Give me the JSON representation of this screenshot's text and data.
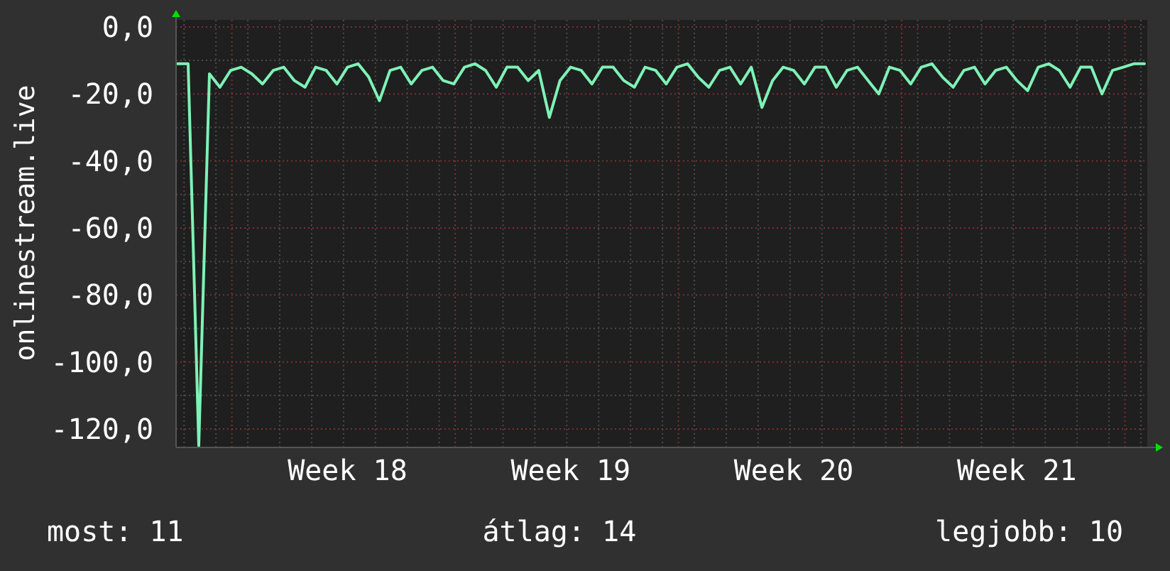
{
  "chart_data": {
    "type": "line",
    "ylabel": "onlinestream.live",
    "grid": true,
    "ylim": [
      -125.5,
      2.1
    ],
    "categories": [
      null,
      null,
      null,
      null,
      null,
      null,
      null,
      null,
      null,
      null,
      null,
      null,
      null,
      null,
      null,
      null,
      "Week 18",
      null,
      null,
      null,
      null,
      null,
      null,
      null,
      null,
      null,
      null,
      null,
      null,
      null,
      null,
      null,
      null,
      null,
      null,
      null,
      null,
      "Week 19",
      null,
      null,
      null,
      null,
      null,
      null,
      null,
      null,
      null,
      null,
      null,
      null,
      null,
      null,
      null,
      null,
      null,
      null,
      null,
      null,
      "Week 20",
      null,
      null,
      null,
      null,
      null,
      null,
      null,
      null,
      null,
      null,
      null,
      null,
      null,
      null,
      null,
      null,
      null,
      null,
      null,
      null,
      "Week 21",
      null,
      null,
      null,
      null,
      null,
      null,
      null,
      null,
      null,
      null,
      null,
      null
    ],
    "yticks": [
      {
        "value": 0,
        "label": "0,0"
      },
      {
        "value": -20,
        "label": "-20,0"
      },
      {
        "value": -40,
        "label": "-40,0"
      },
      {
        "value": -60,
        "label": "-60,0"
      },
      {
        "value": -80,
        "label": "-80,0"
      },
      {
        "value": -100,
        "label": "-100,0"
      },
      {
        "value": -120,
        "label": "-120,0"
      }
    ],
    "series": [
      {
        "color": "#7ef2b6",
        "values": [
          -11,
          -11,
          -125,
          -14,
          -18,
          -13,
          -12,
          -14,
          -17,
          -13,
          -12,
          -16,
          -18,
          -12,
          -13,
          -17,
          -12,
          -11,
          -15,
          -22,
          -13,
          -12,
          -17,
          -13,
          -12,
          -16,
          -17,
          -12,
          -11,
          -13,
          -18,
          -12,
          -12,
          -16,
          -13,
          -27,
          -16,
          -12,
          -13,
          -17,
          -12,
          -12,
          -16,
          -18,
          -12,
          -13,
          -17,
          -12,
          -11,
          -15,
          -18,
          -13,
          -12,
          -17,
          -12,
          -24,
          -16,
          -12,
          -13,
          -17,
          -12,
          -12,
          -18,
          -13,
          -12,
          -16,
          -20,
          -12,
          -13,
          -17,
          -12,
          -11,
          -15,
          -18,
          -13,
          -12,
          -17,
          -13,
          -12,
          -16,
          -19,
          -12,
          -11,
          -13,
          -18,
          -12,
          -12,
          -20,
          -13,
          -12,
          -11,
          -11
        ]
      }
    ]
  },
  "stats": [
    "most: 11",
    "átlag: 14",
    "legjobb: 10"
  ]
}
